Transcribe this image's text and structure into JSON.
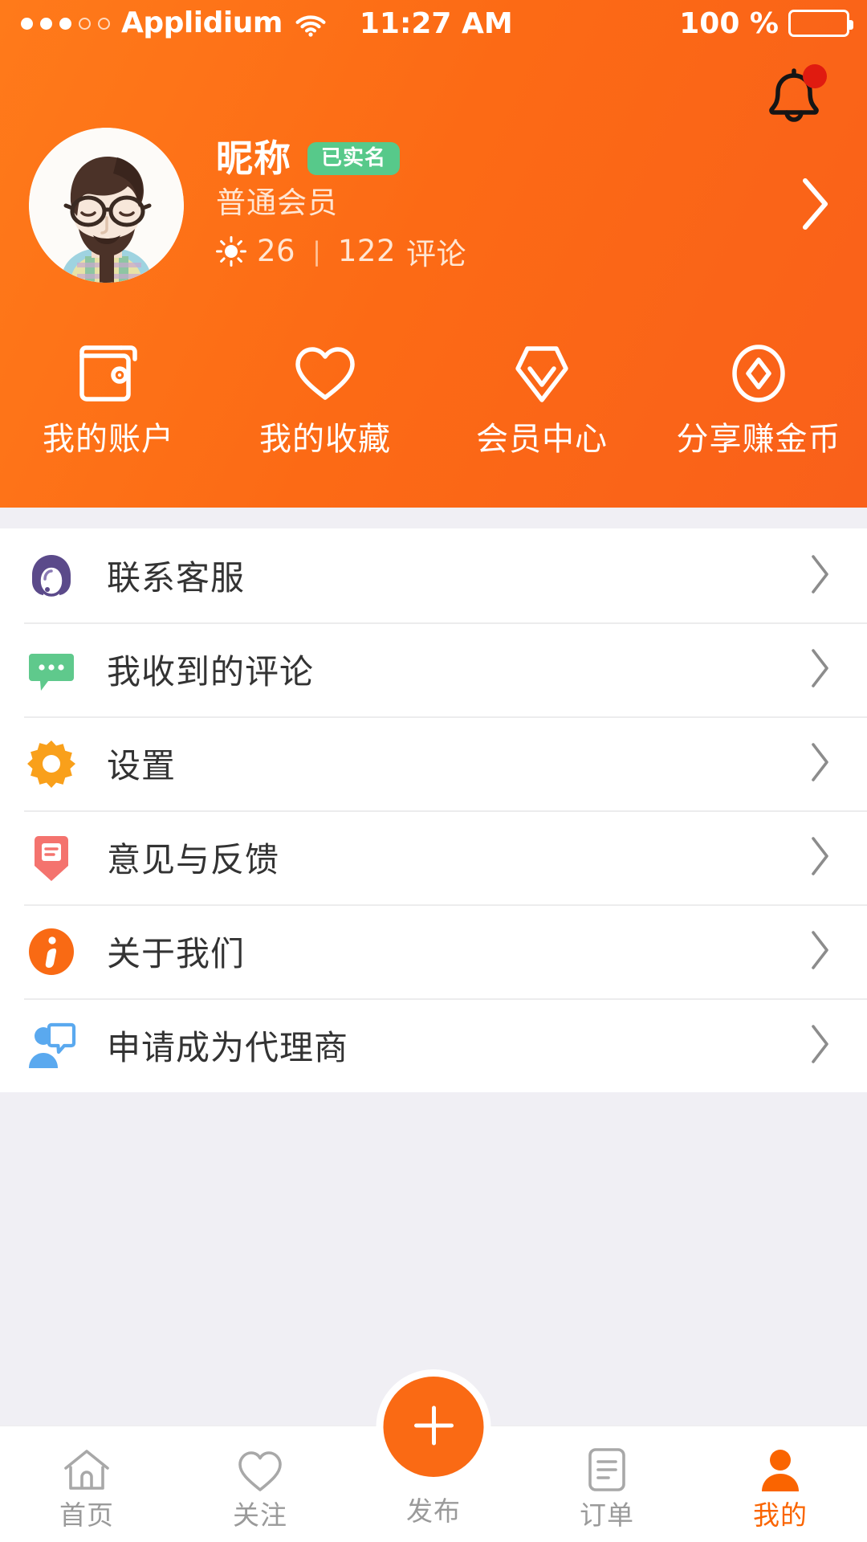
{
  "status_bar": {
    "carrier": "Applidium",
    "time": "11:27 AM",
    "battery_text": "100 %",
    "signal_dots_filled": 3,
    "signal_dots_total": 5,
    "wifi_icon": "wifi-icon",
    "battery_icon": "battery-full-icon"
  },
  "header": {
    "notification": {
      "icon": "bell-icon",
      "has_unread_dot": true,
      "dot_color": "#e01b10"
    },
    "profile": {
      "avatar_icon": "avatar",
      "nickname": "昵称",
      "verified_badge": "已实名",
      "verified_badge_color": "#57c98a",
      "member_level": "普通会员",
      "sun_icon": "sun-icon",
      "sun_value": "26",
      "separator": "|",
      "reviews_count": "122",
      "reviews_label": "评论",
      "chevron_icon": "chevron-right-icon"
    },
    "quick_actions": [
      {
        "label": "我的账户",
        "icon": "wallet-icon"
      },
      {
        "label": "我的收藏",
        "icon": "heart-icon"
      },
      {
        "label": "会员中心",
        "icon": "diamond-icon"
      },
      {
        "label": "分享赚金币",
        "icon": "coin-icon"
      }
    ],
    "background_color": "#fc6a15"
  },
  "menu": {
    "items": [
      {
        "label": "联系客服",
        "icon": "headset-support-icon",
        "icon_color": "#5b4a8a"
      },
      {
        "label": "我收到的评论",
        "icon": "chat-bubble-icon",
        "icon_color": "#5fc98c"
      },
      {
        "label": "设置",
        "icon": "gear-icon",
        "icon_color": "#f9a01b"
      },
      {
        "label": "意见与反馈",
        "icon": "feedback-envelope-icon",
        "icon_color": "#f4736e"
      },
      {
        "label": "关于我们",
        "icon": "info-icon",
        "icon_color": "#f96a14"
      },
      {
        "label": "申请成为代理商",
        "icon": "agent-person-icon",
        "icon_color": "#5aa9ef"
      }
    ],
    "chevron_icon": "chevron-right-icon"
  },
  "tabbar": {
    "active_color": "#fa6400",
    "inactive_color": "#9a9a9a",
    "items": [
      {
        "label": "首页",
        "icon": "home-icon",
        "active": false
      },
      {
        "label": "关注",
        "icon": "heart-icon",
        "active": false
      },
      {
        "label": "发布",
        "icon": "plus-icon",
        "active": false,
        "is_fab": true
      },
      {
        "label": "订单",
        "icon": "order-list-icon",
        "active": false
      },
      {
        "label": "我的",
        "icon": "person-icon",
        "active": true
      }
    ]
  }
}
